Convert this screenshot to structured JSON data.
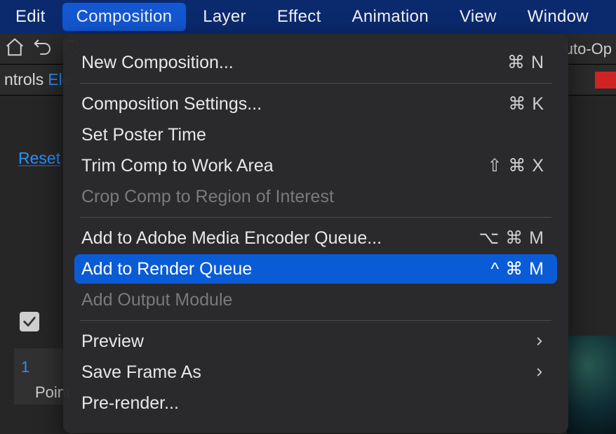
{
  "menubar": {
    "items": [
      {
        "label": "Edit"
      },
      {
        "label": "Composition"
      },
      {
        "label": "Layer"
      },
      {
        "label": "Effect"
      },
      {
        "label": "Animation"
      },
      {
        "label": "View"
      },
      {
        "label": "Window"
      }
    ],
    "active_index": 1
  },
  "toolbar": {
    "right_label": "uto-Op"
  },
  "left_panel": {
    "tab_prefix": "ntrols",
    "tab_selection": "Ele",
    "reset_label": "Reset",
    "row_number": "1",
    "point_label": "Point"
  },
  "dropdown": {
    "items": [
      {
        "label": "New Composition...",
        "shortcut": "⌘ N",
        "enabled": true,
        "highlight": false,
        "submenu": false
      },
      {
        "separator": true
      },
      {
        "label": "Composition Settings...",
        "shortcut": "⌘ K",
        "enabled": true,
        "highlight": false,
        "submenu": false
      },
      {
        "label": "Set Poster Time",
        "shortcut": "",
        "enabled": true,
        "highlight": false,
        "submenu": false
      },
      {
        "label": "Trim Comp to Work Area",
        "shortcut": "⇧ ⌘ X",
        "enabled": true,
        "highlight": false,
        "submenu": false
      },
      {
        "label": "Crop Comp to Region of Interest",
        "shortcut": "",
        "enabled": false,
        "highlight": false,
        "submenu": false
      },
      {
        "separator": true
      },
      {
        "label": "Add to Adobe Media Encoder Queue...",
        "shortcut": "⌥ ⌘ M",
        "enabled": true,
        "highlight": false,
        "submenu": false
      },
      {
        "label": "Add to Render Queue",
        "shortcut": "^ ⌘ M",
        "enabled": true,
        "highlight": true,
        "submenu": false
      },
      {
        "label": "Add Output Module",
        "shortcut": "",
        "enabled": false,
        "highlight": false,
        "submenu": false
      },
      {
        "separator": true
      },
      {
        "label": "Preview",
        "shortcut": "",
        "enabled": true,
        "highlight": false,
        "submenu": true
      },
      {
        "label": "Save Frame As",
        "shortcut": "",
        "enabled": true,
        "highlight": false,
        "submenu": true
      },
      {
        "label": "Pre-render...",
        "shortcut": "",
        "enabled": true,
        "highlight": false,
        "submenu": false
      }
    ]
  }
}
